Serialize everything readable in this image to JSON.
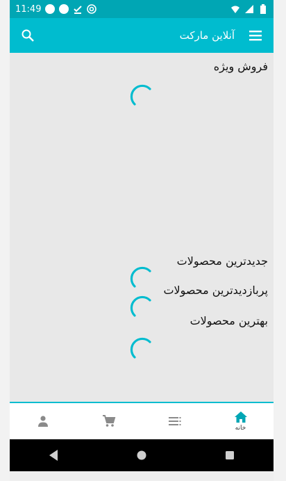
{
  "status_bar": {
    "time": "11:49",
    "left_icons": [
      "circle-icon",
      "circle-icon",
      "download-done-icon",
      "at-sign-icon"
    ],
    "right_icons": [
      "wifi-icon",
      "signal-icon",
      "battery-icon"
    ]
  },
  "app_bar": {
    "title": "آنلاین مارکت",
    "menu_icon": "menu-icon",
    "search_icon": "search-icon"
  },
  "sections": {
    "special_sale": "فروش ویژه",
    "newest_products": "جدیدترین محصولات",
    "most_viewed_products": "پربازدیدترین محصولات",
    "best_products": "بهترین محصولات"
  },
  "bottom_nav": {
    "items": [
      {
        "icon": "person-icon",
        "label": ""
      },
      {
        "icon": "cart-icon",
        "label": ""
      },
      {
        "icon": "list-icon",
        "label": ""
      },
      {
        "icon": "home-icon",
        "label": "خانه"
      }
    ]
  },
  "colors": {
    "status_bar": "#00a6b4",
    "app_bar": "#00bccf",
    "content_bg": "#e8e8e8",
    "spinner": "#00bccf",
    "active_nav": "#00a6b4"
  }
}
